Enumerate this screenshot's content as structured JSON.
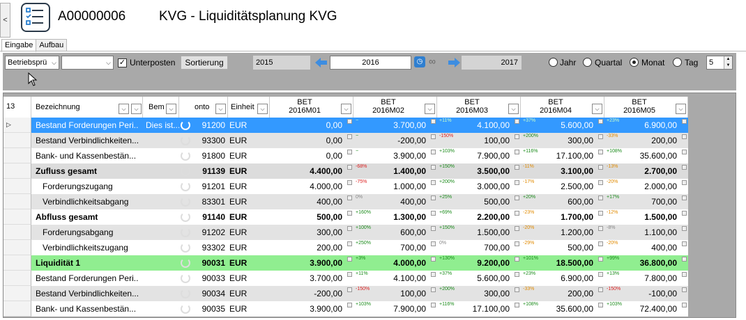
{
  "header": {
    "code": "A00000006",
    "title": "KVG - Liquiditätsplanung KVG",
    "collapse": "<"
  },
  "tabs": [
    {
      "label": "Eingabe",
      "active": true
    },
    {
      "label": "Aufbau",
      "active": false
    }
  ],
  "toolbar": {
    "combo1": "Betriebsprü",
    "combo2": "",
    "unterposten_label": "Unterposten",
    "unterposten_checked": true,
    "sort_label": "Sortierung",
    "year_prev": "2015",
    "year_current": "2016",
    "year_next": "2017",
    "periods": [
      {
        "label": "Jahr",
        "selected": false
      },
      {
        "label": "Quartal",
        "selected": false
      },
      {
        "label": "Monat",
        "selected": true
      },
      {
        "label": "Tag",
        "selected": false
      }
    ],
    "count": "5"
  },
  "grid": {
    "row_count": "13",
    "columns": {
      "bezeichnung": "Bezeichnung",
      "bem": "Bem",
      "konto": "onto",
      "einheit": "Einheit",
      "months": [
        {
          "l1": "BET",
          "l2": "2016M01"
        },
        {
          "l1": "BET",
          "l2": "2016M02"
        },
        {
          "l1": "BET",
          "l2": "2016M03"
        },
        {
          "l1": "BET",
          "l2": "2016M04"
        },
        {
          "l1": "BET",
          "l2": "2016M05"
        }
      ]
    },
    "rows": [
      {
        "name": "Bestand Forderungen Peri...",
        "bem": "Dies ist...",
        "konto": "91200",
        "unit": "EUR",
        "style": "selected",
        "indent": 0,
        "v": [
          "0,00",
          "3.700,00",
          "4.100,00",
          "5.600,00",
          "6.900,00"
        ],
        "p": [
          "",
          "−",
          "+11%",
          "+37%",
          "+23%"
        ],
        "pc": [
          "",
          "pos",
          "pos",
          "pos",
          "pos"
        ]
      },
      {
        "name": "Bestand Verbindlichkeiten...",
        "bem": "",
        "konto": "93300",
        "unit": "EUR",
        "style": "alt",
        "indent": 0,
        "v": [
          "0,00",
          "-200,00",
          "100,00",
          "300,00",
          "200,00"
        ],
        "p": [
          "",
          "−",
          "-150%",
          "+200%",
          "-33%"
        ],
        "pc": [
          "",
          "pos",
          "neg",
          "pos",
          "warn"
        ]
      },
      {
        "name": "Bank- und Kassenbestän...",
        "bem": "",
        "konto": "91800",
        "unit": "EUR",
        "style": "white",
        "indent": 0,
        "v": [
          "0,00",
          "3.900,00",
          "7.900,00",
          "17.100,00",
          "35.600,00"
        ],
        "p": [
          "",
          "−",
          "+103%",
          "+116%",
          "+108%"
        ],
        "pc": [
          "",
          "pos",
          "pos",
          "pos",
          "pos"
        ]
      },
      {
        "name": "Zufluss gesamt",
        "bem": "",
        "konto": "91139",
        "unit": "EUR",
        "style": "sum",
        "indent": 0,
        "v": [
          "4.400,00",
          "1.400,00",
          "3.500,00",
          "3.100,00",
          "2.700,00"
        ],
        "p": [
          "",
          "-68%",
          "+150%",
          "-11%",
          "-13%"
        ],
        "pc": [
          "",
          "neg",
          "pos",
          "warn",
          "warn"
        ]
      },
      {
        "name": "Forderungszugang",
        "bem": "",
        "konto": "91201",
        "unit": "EUR",
        "style": "white",
        "indent": 1,
        "v": [
          "4.000,00",
          "1.000,00",
          "3.000,00",
          "2.500,00",
          "2.000,00"
        ],
        "p": [
          "",
          "-75%",
          "+200%",
          "-17%",
          "-20%"
        ],
        "pc": [
          "",
          "neg",
          "pos",
          "warn",
          "warn"
        ]
      },
      {
        "name": "Verbindlichkeitsabgang",
        "bem": "",
        "konto": "83301",
        "unit": "EUR",
        "style": "alt",
        "indent": 1,
        "v": [
          "400,00",
          "400,00",
          "500,00",
          "600,00",
          "700,00"
        ],
        "p": [
          "",
          "0%",
          "+25%",
          "+20%",
          "+17%"
        ],
        "pc": [
          "",
          "neu",
          "pos",
          "pos",
          "pos"
        ]
      },
      {
        "name": "Abfluss gesamt",
        "bem": "",
        "konto": "91140",
        "unit": "EUR",
        "style": "sum-white",
        "indent": 0,
        "v": [
          "500,00",
          "1.300,00",
          "2.200,00",
          "1.700,00",
          "1.500,00"
        ],
        "p": [
          "",
          "+160%",
          "+69%",
          "-23%",
          "-12%"
        ],
        "pc": [
          "",
          "pos",
          "pos",
          "warn",
          "warn"
        ]
      },
      {
        "name": "Forderungsabgang",
        "bem": "",
        "konto": "91202",
        "unit": "EUR",
        "style": "alt",
        "indent": 1,
        "v": [
          "300,00",
          "600,00",
          "1.500,00",
          "1.200,00",
          "1.100,00"
        ],
        "p": [
          "",
          "+100%",
          "+150%",
          "-20%",
          "-8%"
        ],
        "pc": [
          "",
          "pos",
          "pos",
          "warn",
          "neu"
        ]
      },
      {
        "name": "Verbindlichkeitszugang",
        "bem": "",
        "konto": "93302",
        "unit": "EUR",
        "style": "white",
        "indent": 1,
        "v": [
          "200,00",
          "700,00",
          "700,00",
          "500,00",
          "400,00"
        ],
        "p": [
          "",
          "+250%",
          "0%",
          "-29%",
          "-20%"
        ],
        "pc": [
          "",
          "pos",
          "neu",
          "warn",
          "warn"
        ]
      },
      {
        "name": "Liquidität 1",
        "bem": "",
        "konto": "90031",
        "unit": "EUR",
        "style": "green",
        "indent": 0,
        "v": [
          "3.900,00",
          "4.000,00",
          "9.200,00",
          "18.500,00",
          "36.800,00"
        ],
        "p": [
          "",
          "+3%",
          "+130%",
          "+101%",
          "+99%"
        ],
        "pc": [
          "",
          "pos",
          "pos",
          "pos",
          "pos"
        ]
      },
      {
        "name": "Bestand Forderungen Peri...",
        "bem": "",
        "konto": "90033",
        "unit": "EUR",
        "style": "white",
        "indent": 0,
        "v": [
          "3.700,00",
          "4.100,00",
          "5.600,00",
          "6.900,00",
          "7.800,00"
        ],
        "p": [
          "",
          "+11%",
          "+37%",
          "+23%",
          "+13%"
        ],
        "pc": [
          "",
          "pos",
          "pos",
          "pos",
          "pos"
        ]
      },
      {
        "name": "Bestand Verbindlichkeiten...",
        "bem": "",
        "konto": "90034",
        "unit": "EUR",
        "style": "alt",
        "indent": 0,
        "v": [
          "-200,00",
          "100,00",
          "300,00",
          "200,00",
          "-100,00"
        ],
        "p": [
          "",
          "-150%",
          "+200%",
          "-33%",
          "-150%"
        ],
        "pc": [
          "",
          "neg",
          "pos",
          "warn",
          "neg"
        ]
      },
      {
        "name": "Bank- und Kassenbestän...",
        "bem": "",
        "konto": "90035",
        "unit": "EUR",
        "style": "white",
        "indent": 0,
        "v": [
          "3.900,00",
          "7.900,00",
          "17.100,00",
          "35.600,00",
          "72.400,00"
        ],
        "p": [
          "",
          "+103%",
          "+116%",
          "+108%",
          "+103%"
        ],
        "pc": [
          "",
          "pos",
          "pos",
          "pos",
          "pos"
        ]
      }
    ]
  },
  "colors": {
    "selected": "#3399ff",
    "alt": "#e3e3e3",
    "green": "#90ee90",
    "sum": "#dcdcdc",
    "toolbar": "#a9a9a9"
  }
}
